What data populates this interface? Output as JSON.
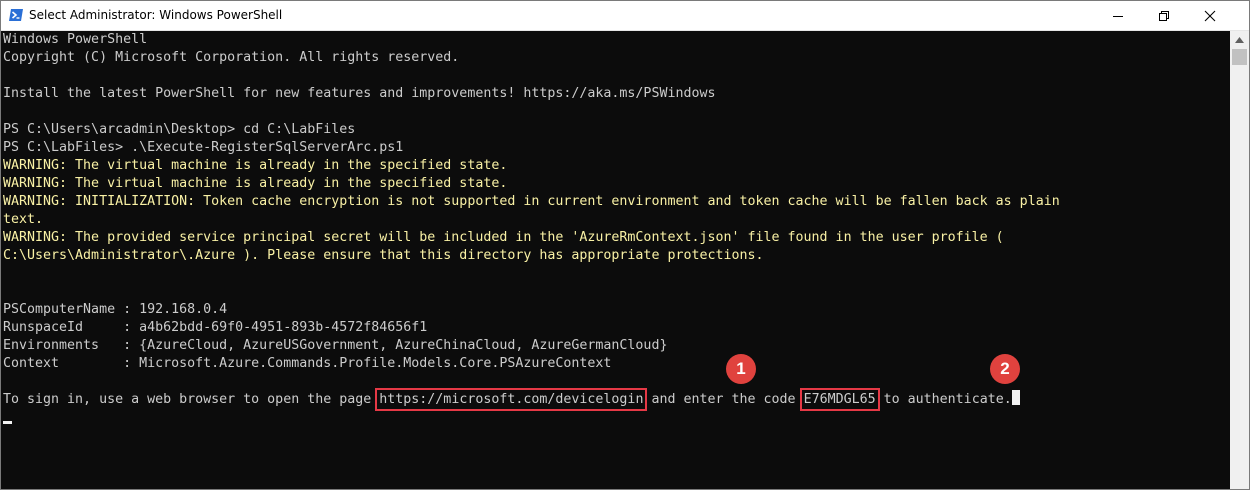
{
  "window": {
    "title": "Select Administrator: Windows PowerShell",
    "icons": {
      "app": "powershell-icon",
      "minimize": "minimize-icon",
      "maximize": "restore-icon",
      "close": "close-icon"
    }
  },
  "console": {
    "colors": {
      "background": "#0c0c0c",
      "text": "#cccccc",
      "warning": "#f9f1a5",
      "highlight": "#e63946",
      "badge": "#e0423e"
    },
    "lines": [
      "Windows PowerShell",
      "Copyright (C) Microsoft Corporation. All rights reserved.",
      "",
      "Install the latest PowerShell for new features and improvements! https://aka.ms/PSWindows",
      "",
      "PS C:\\Users\\arcadmin\\Desktop> cd C:\\LabFiles",
      "PS C:\\LabFiles> .\\Execute-RegisterSqlServerArc.ps1",
      "WARNING: The virtual machine is already in the specified state.",
      "WARNING: The virtual machine is already in the specified state.",
      "WARNING: INITIALIZATION: Token cache encryption is not supported in current environment and token cache will be fallen back as plain",
      "text.",
      "WARNING: The provided service principal secret will be included in the 'AzureRmContext.json' file found in the user profile (",
      "C:\\Users\\Administrator\\.Azure ). Please ensure that this directory has appropriate protections.",
      "",
      "",
      "",
      "PSComputerName : 192.168.0.4",
      "RunspaceId     : a4b62bdd-69f0-4951-893b-4572f84656f1",
      "Environments   : {AzureCloud, AzureUSGovernment, AzureChinaCloud, AzureGermanCloud}",
      "Context        : Microsoft.Azure.Commands.Profile.Models.Core.PSAzureContext"
    ],
    "signin": {
      "prefix": "To sign in, use a web browser to open the page ",
      "url": "https://microsoft.com/devicelogin",
      "middle": " and enter the code ",
      "code": "E76MDGL65",
      "suffix": " to authenticate."
    }
  },
  "callouts": [
    "1",
    "2"
  ]
}
